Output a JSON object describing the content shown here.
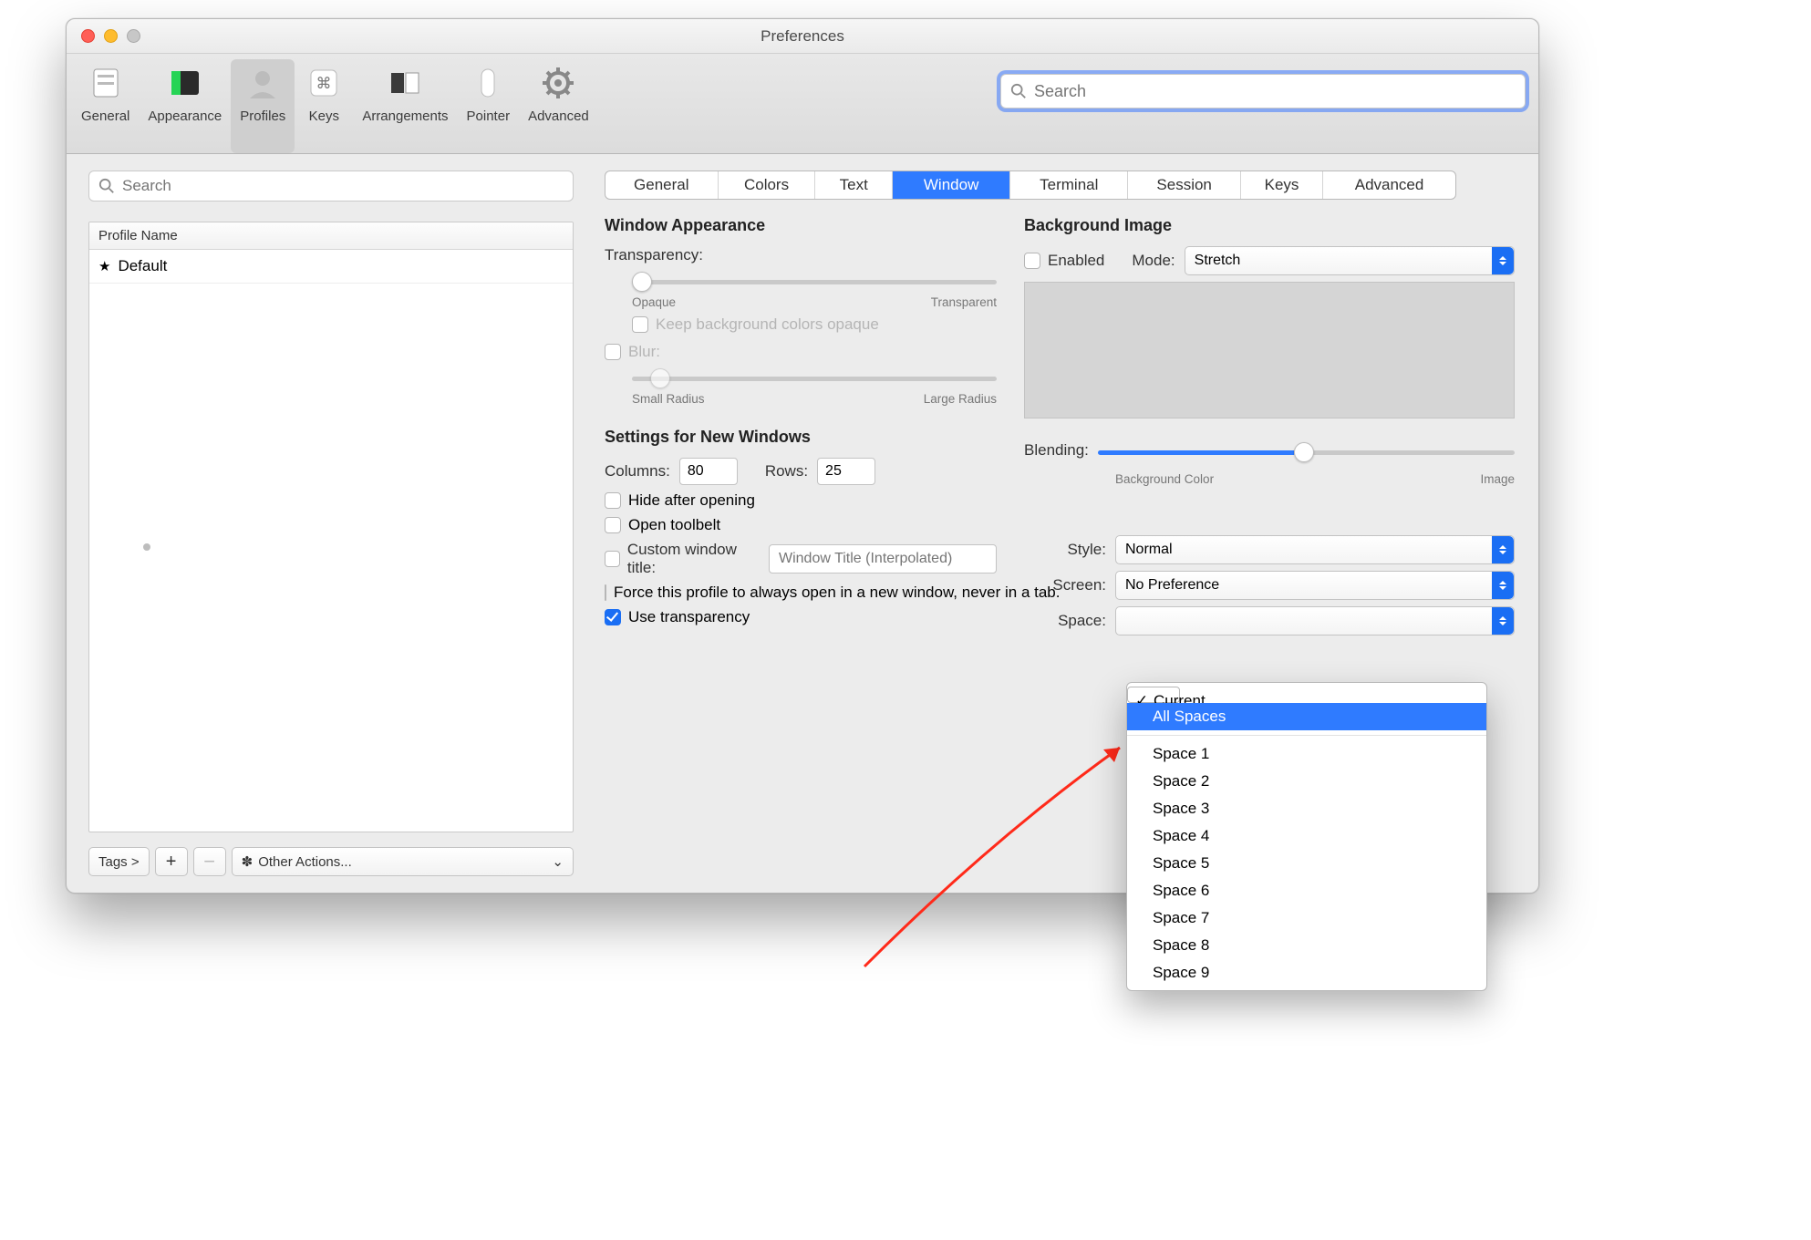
{
  "window": {
    "title": "Preferences"
  },
  "toolbar": {
    "items": [
      "General",
      "Appearance",
      "Profiles",
      "Keys",
      "Arrangements",
      "Pointer",
      "Advanced"
    ],
    "active": "Profiles",
    "search_placeholder": "Search"
  },
  "sidebar": {
    "search_placeholder": "Search",
    "column": "Profile Name",
    "profiles": [
      {
        "name": "Default",
        "starred": true
      }
    ],
    "tags_btn": "Tags >",
    "other_actions": "Other Actions..."
  },
  "tabs": {
    "items": [
      "General",
      "Colors",
      "Text",
      "Window",
      "Terminal",
      "Session",
      "Keys",
      "Advanced"
    ],
    "active": "Window"
  },
  "left": {
    "h_appearance": "Window Appearance",
    "transparency_label": "Transparency:",
    "opaque": "Opaque",
    "transparent": "Transparent",
    "keep_bg": "Keep background colors opaque",
    "blur_label": "Blur:",
    "small_radius": "Small Radius",
    "large_radius": "Large Radius",
    "h_settings": "Settings for New Windows",
    "columns_label": "Columns:",
    "columns_value": "80",
    "rows_label": "Rows:",
    "rows_value": "25",
    "hide_after": "Hide after opening",
    "open_toolbelt": "Open toolbelt",
    "custom_title": "Custom window title:",
    "title_placeholder": "Window Title (Interpolated)",
    "force_new": "Force this profile to always open in a new window, never in a tab.",
    "use_trans": "Use transparency"
  },
  "right": {
    "h_bg": "Background Image",
    "enabled": "Enabled",
    "mode_label": "Mode:",
    "mode_value": "Stretch",
    "blending_label": "Blending:",
    "bg_color": "Background Color",
    "image": "Image",
    "style_label": "Style:",
    "style_value": "Normal",
    "screen_label": "Screen:",
    "screen_value": "No Preference",
    "space_label": "Space:"
  },
  "menu": {
    "checked": "Current Space",
    "selected": "All Spaces",
    "spaces": [
      "Space 1",
      "Space 2",
      "Space 3",
      "Space 4",
      "Space 5",
      "Space 6",
      "Space 7",
      "Space 8",
      "Space 9"
    ]
  }
}
